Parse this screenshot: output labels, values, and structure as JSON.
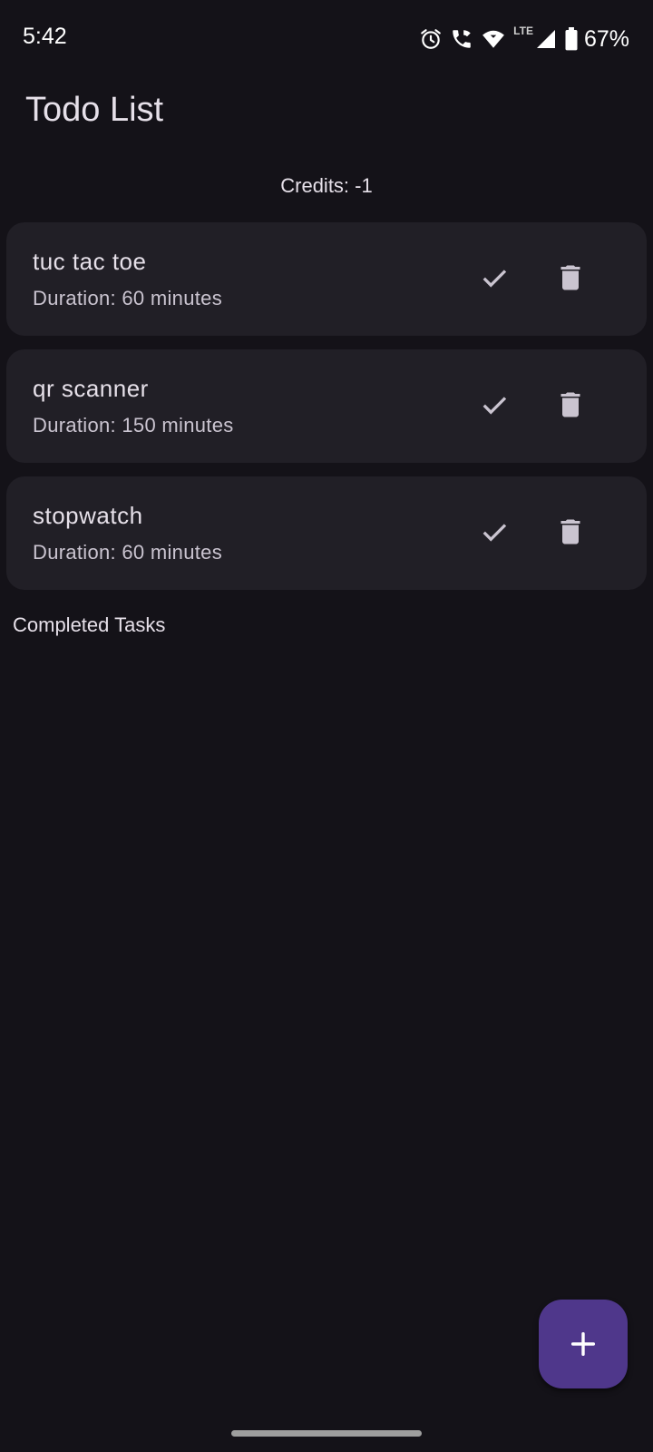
{
  "status_bar": {
    "time": "5:42",
    "lte": "LTE",
    "battery": "67%",
    "icons": [
      "alarm-icon",
      "wifi-call-icon",
      "wifi-icon",
      "signal-icon",
      "battery-icon"
    ]
  },
  "app": {
    "title": "Todo List",
    "credits": "Credits: -1",
    "completed_heading": "Completed Tasks"
  },
  "tasks": [
    {
      "name": "tuc tac toe",
      "duration": "Duration: 60 minutes"
    },
    {
      "name": "qr scanner",
      "duration": "Duration: 150 minutes"
    },
    {
      "name": "stopwatch",
      "duration": "Duration: 60 minutes"
    }
  ],
  "colors": {
    "background": "#141218",
    "card": "#211f26",
    "fab": "#4f378b",
    "text": "#e6e0e9",
    "subtext": "#cac4d0"
  },
  "fab": {
    "icon": "plus-icon"
  }
}
